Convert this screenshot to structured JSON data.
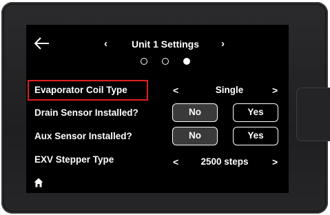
{
  "header": {
    "title": "Unit 1 Settings",
    "prev_glyph": "‹",
    "next_glyph": "›",
    "back_icon": "arrow-left-icon"
  },
  "pager": {
    "count": 3,
    "active_index": 2
  },
  "rows": {
    "evaporator": {
      "label": "Evaporator Coil Type",
      "value": "Single",
      "prev_glyph": "<",
      "next_glyph": ">",
      "highlighted": true,
      "highlight_color": "#e02020"
    },
    "drain": {
      "label": "Drain Sensor Installed?",
      "no_label": "No",
      "yes_label": "Yes",
      "selected": "No"
    },
    "aux": {
      "label": "Aux Sensor Installed?",
      "no_label": "No",
      "yes_label": "Yes",
      "selected": "No"
    },
    "exv": {
      "label": "EXV Stepper Type",
      "value": "2500 steps",
      "prev_glyph": "<",
      "next_glyph": ">"
    }
  },
  "footer": {
    "home_icon": "home-icon"
  },
  "colors": {
    "screen_bg": "#000000",
    "text": "#ffffff",
    "selected_button_bg": "#3a3a3a",
    "bezel": "#2b2b2d"
  }
}
